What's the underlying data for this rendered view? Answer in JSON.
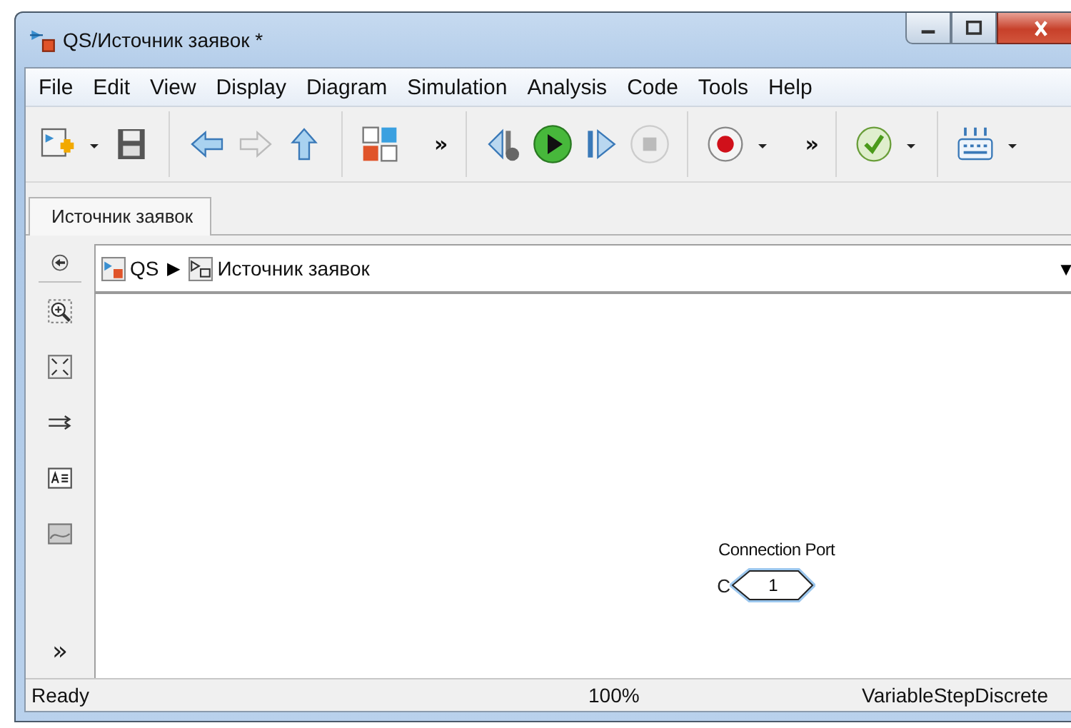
{
  "window": {
    "title": "QS/Источник заявок *"
  },
  "menu": [
    "File",
    "Edit",
    "View",
    "Display",
    "Diagram",
    "Simulation",
    "Analysis",
    "Code",
    "Tools",
    "Help"
  ],
  "toolbar": {
    "overflow_1": "»",
    "overflow_2": "»"
  },
  "tabs": [
    {
      "label": "Источник заявок",
      "selected": true
    }
  ],
  "breadcrumb": {
    "items": [
      "QS",
      "Источник заявок"
    ],
    "separator": "▶",
    "dropdown": "▼"
  },
  "palette": {
    "more": "»"
  },
  "canvas": {
    "blocks": [
      {
        "kind": "connection-port",
        "label": "Connection Port",
        "value": "1",
        "port": "C"
      }
    ]
  },
  "status_bar": {
    "state": "Ready",
    "zoom": "100%",
    "solver": "VariableStepDiscrete"
  }
}
